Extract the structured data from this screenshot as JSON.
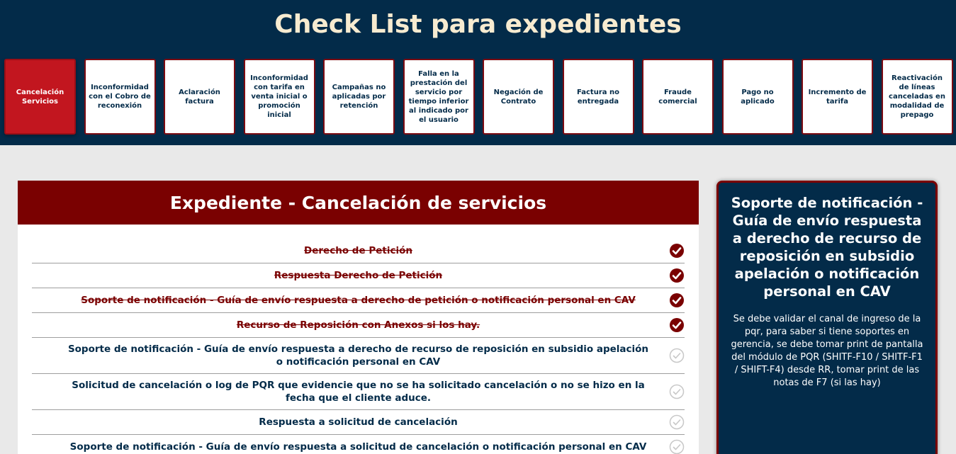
{
  "header": {
    "title": "Check List para expedientes"
  },
  "categories": [
    {
      "label": "Cancelación Servicios",
      "active": true
    },
    {
      "label": "Inconformidad con el Cobro de reconexión"
    },
    {
      "label": "Aclaración factura"
    },
    {
      "label": "Inconformidad con tarifa en venta inicial o promoción inicial"
    },
    {
      "label": "Campañas no aplicadas por retención"
    },
    {
      "label": "Falla en la prestación del servicio por tiempo inferior al indicado por el usuario"
    },
    {
      "label": "Negación de Contrato"
    },
    {
      "label": "Factura no entregada"
    },
    {
      "label": "Fraude comercial"
    },
    {
      "label": "Pago no aplicado"
    },
    {
      "label": "Incremento de tarifa"
    },
    {
      "label": "Reactivación de líneas canceladas en modalidad de prepago"
    }
  ],
  "expediente": {
    "title": "Expediente - Cancelación de servicios",
    "items": [
      {
        "text": "Derecho de Petición",
        "checked": true
      },
      {
        "text": "Respuesta Derecho de Petición",
        "checked": true
      },
      {
        "text": "Soporte de notificación - Guía de envío respuesta a derecho de petición o notificación personal en CAV",
        "checked": true
      },
      {
        "text": "Recurso de Reposición con Anexos si los hay.",
        "checked": true
      },
      {
        "text": "Soporte de notificación - Guía de envío respuesta a derecho de recurso de reposición en subsidio apelación o notificación personal en CAV",
        "checked": false
      },
      {
        "text": "Solicitud de cancelación o log de PQR que evidencie que no se ha solicitado cancelación o no se hizo en la fecha que el cliente aduce.",
        "checked": false
      },
      {
        "text": "Respuesta a solicitud de cancelación",
        "checked": false
      },
      {
        "text": "Soporte de notificación - Guía de envío respuesta a solicitud de cancelación o notificación personal en CAV",
        "checked": false
      }
    ]
  },
  "info": {
    "title": "Soporte de notificación - Guía de envío respuesta a derecho de recurso de reposición en subsidio apelación o notificación personal en CAV",
    "body": "Se debe validar el canal de ingreso de la pqr, para saber si tiene soportes en gerencia, se debe tomar print de pantalla del módulo de PQR (SHITF-F10 / SHITF-F1 / SHIFT-F4) desde RR, tomar print de las notas de F7 (si las hay)"
  },
  "colors": {
    "navy": "#032b49",
    "maroon": "#7a0101",
    "active_red": "#c2161f",
    "title_cream": "#f7ebd0",
    "unchecked_gray": "#c8c8c8"
  },
  "icons": {
    "checked": "check-circle-filled-icon",
    "unchecked": "check-circle-outline-icon"
  }
}
